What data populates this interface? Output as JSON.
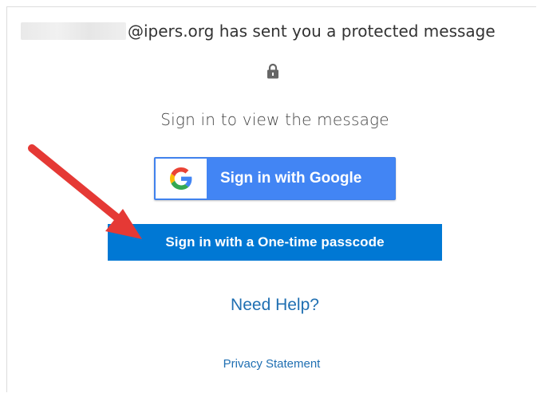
{
  "header": {
    "sender_domain": "@ipers.org",
    "sender_message": "@ipers.org has sent you a protected message"
  },
  "icons": {
    "lock": "lock-icon",
    "google": "google-logo-icon",
    "annotation": "red-arrow"
  },
  "main": {
    "subtitle": "Sign in to view the message",
    "google_button_label": "Sign in with Google",
    "otp_button_label": "Sign in with a One-time passcode",
    "help_link": "Need Help?",
    "privacy_link": "Privacy Statement"
  },
  "colors": {
    "google_blue": "#4285f4",
    "otp_blue": "#0078d4",
    "link_blue": "#1f6fb2",
    "arrow_red": "#e53935"
  }
}
